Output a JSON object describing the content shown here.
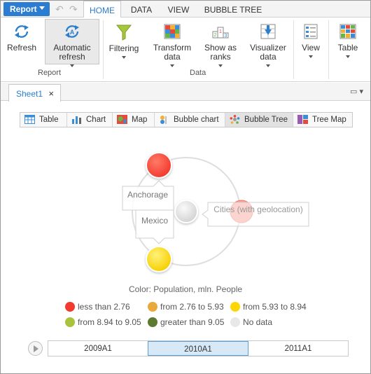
{
  "topbar": {
    "report_label": "Report",
    "tabs": [
      {
        "label": "HOME",
        "active": true
      },
      {
        "label": "DATA"
      },
      {
        "label": "VIEW"
      },
      {
        "label": "BUBBLE TREE"
      }
    ]
  },
  "ribbon": {
    "refresh": "Refresh",
    "automatic_refresh_line1": "Automatic",
    "automatic_refresh_line2": "refresh",
    "filtering": "Filtering",
    "transform_line1": "Transform",
    "transform_line2": "data",
    "show_ranks_line1": "Show as",
    "show_ranks_line2": "ranks",
    "visualizer_line1": "Visualizer",
    "visualizer_line2": "data",
    "view": "View",
    "table": "Table",
    "group_report": "Report",
    "group_data": "Data"
  },
  "sheet": {
    "tab_label": "Sheet1",
    "close_icon": "×"
  },
  "switcher": [
    {
      "label": "Table",
      "icon": "table-icon"
    },
    {
      "label": "Chart",
      "icon": "chart-icon"
    },
    {
      "label": "Map",
      "icon": "map-icon"
    },
    {
      "label": "Bubble chart",
      "icon": "bubble-chart-icon"
    },
    {
      "label": "Bubble Tree",
      "icon": "bubble-tree-icon",
      "active": true
    },
    {
      "label": "Tree Map",
      "icon": "tree-map-icon"
    }
  ],
  "bubble_tree": {
    "center_label": "Cities (with geolocation)",
    "nodes": [
      {
        "label": "Anchorage",
        "color": "#ff4530"
      },
      {
        "label": "Mexico",
        "color": "#ffd600"
      }
    ]
  },
  "legend": {
    "title": "Color: Population, mln. People",
    "items": [
      {
        "label": "less than 2.76",
        "color": "#f23a2f"
      },
      {
        "label": "from 2.76 to 5.93",
        "color": "#e9a93a"
      },
      {
        "label": "from 5.93 to 8.94",
        "color": "#ffd600"
      },
      {
        "label": "from 8.94 to 9.05",
        "color": "#a9c33c"
      },
      {
        "label": "greater than 9.05",
        "color": "#5d7a31"
      },
      {
        "label": "No data",
        "color": "#e8e8e8"
      }
    ]
  },
  "timeline": {
    "items": [
      {
        "label": "2009A1"
      },
      {
        "label": "2010A1",
        "active": true
      },
      {
        "label": "2011A1"
      }
    ]
  }
}
